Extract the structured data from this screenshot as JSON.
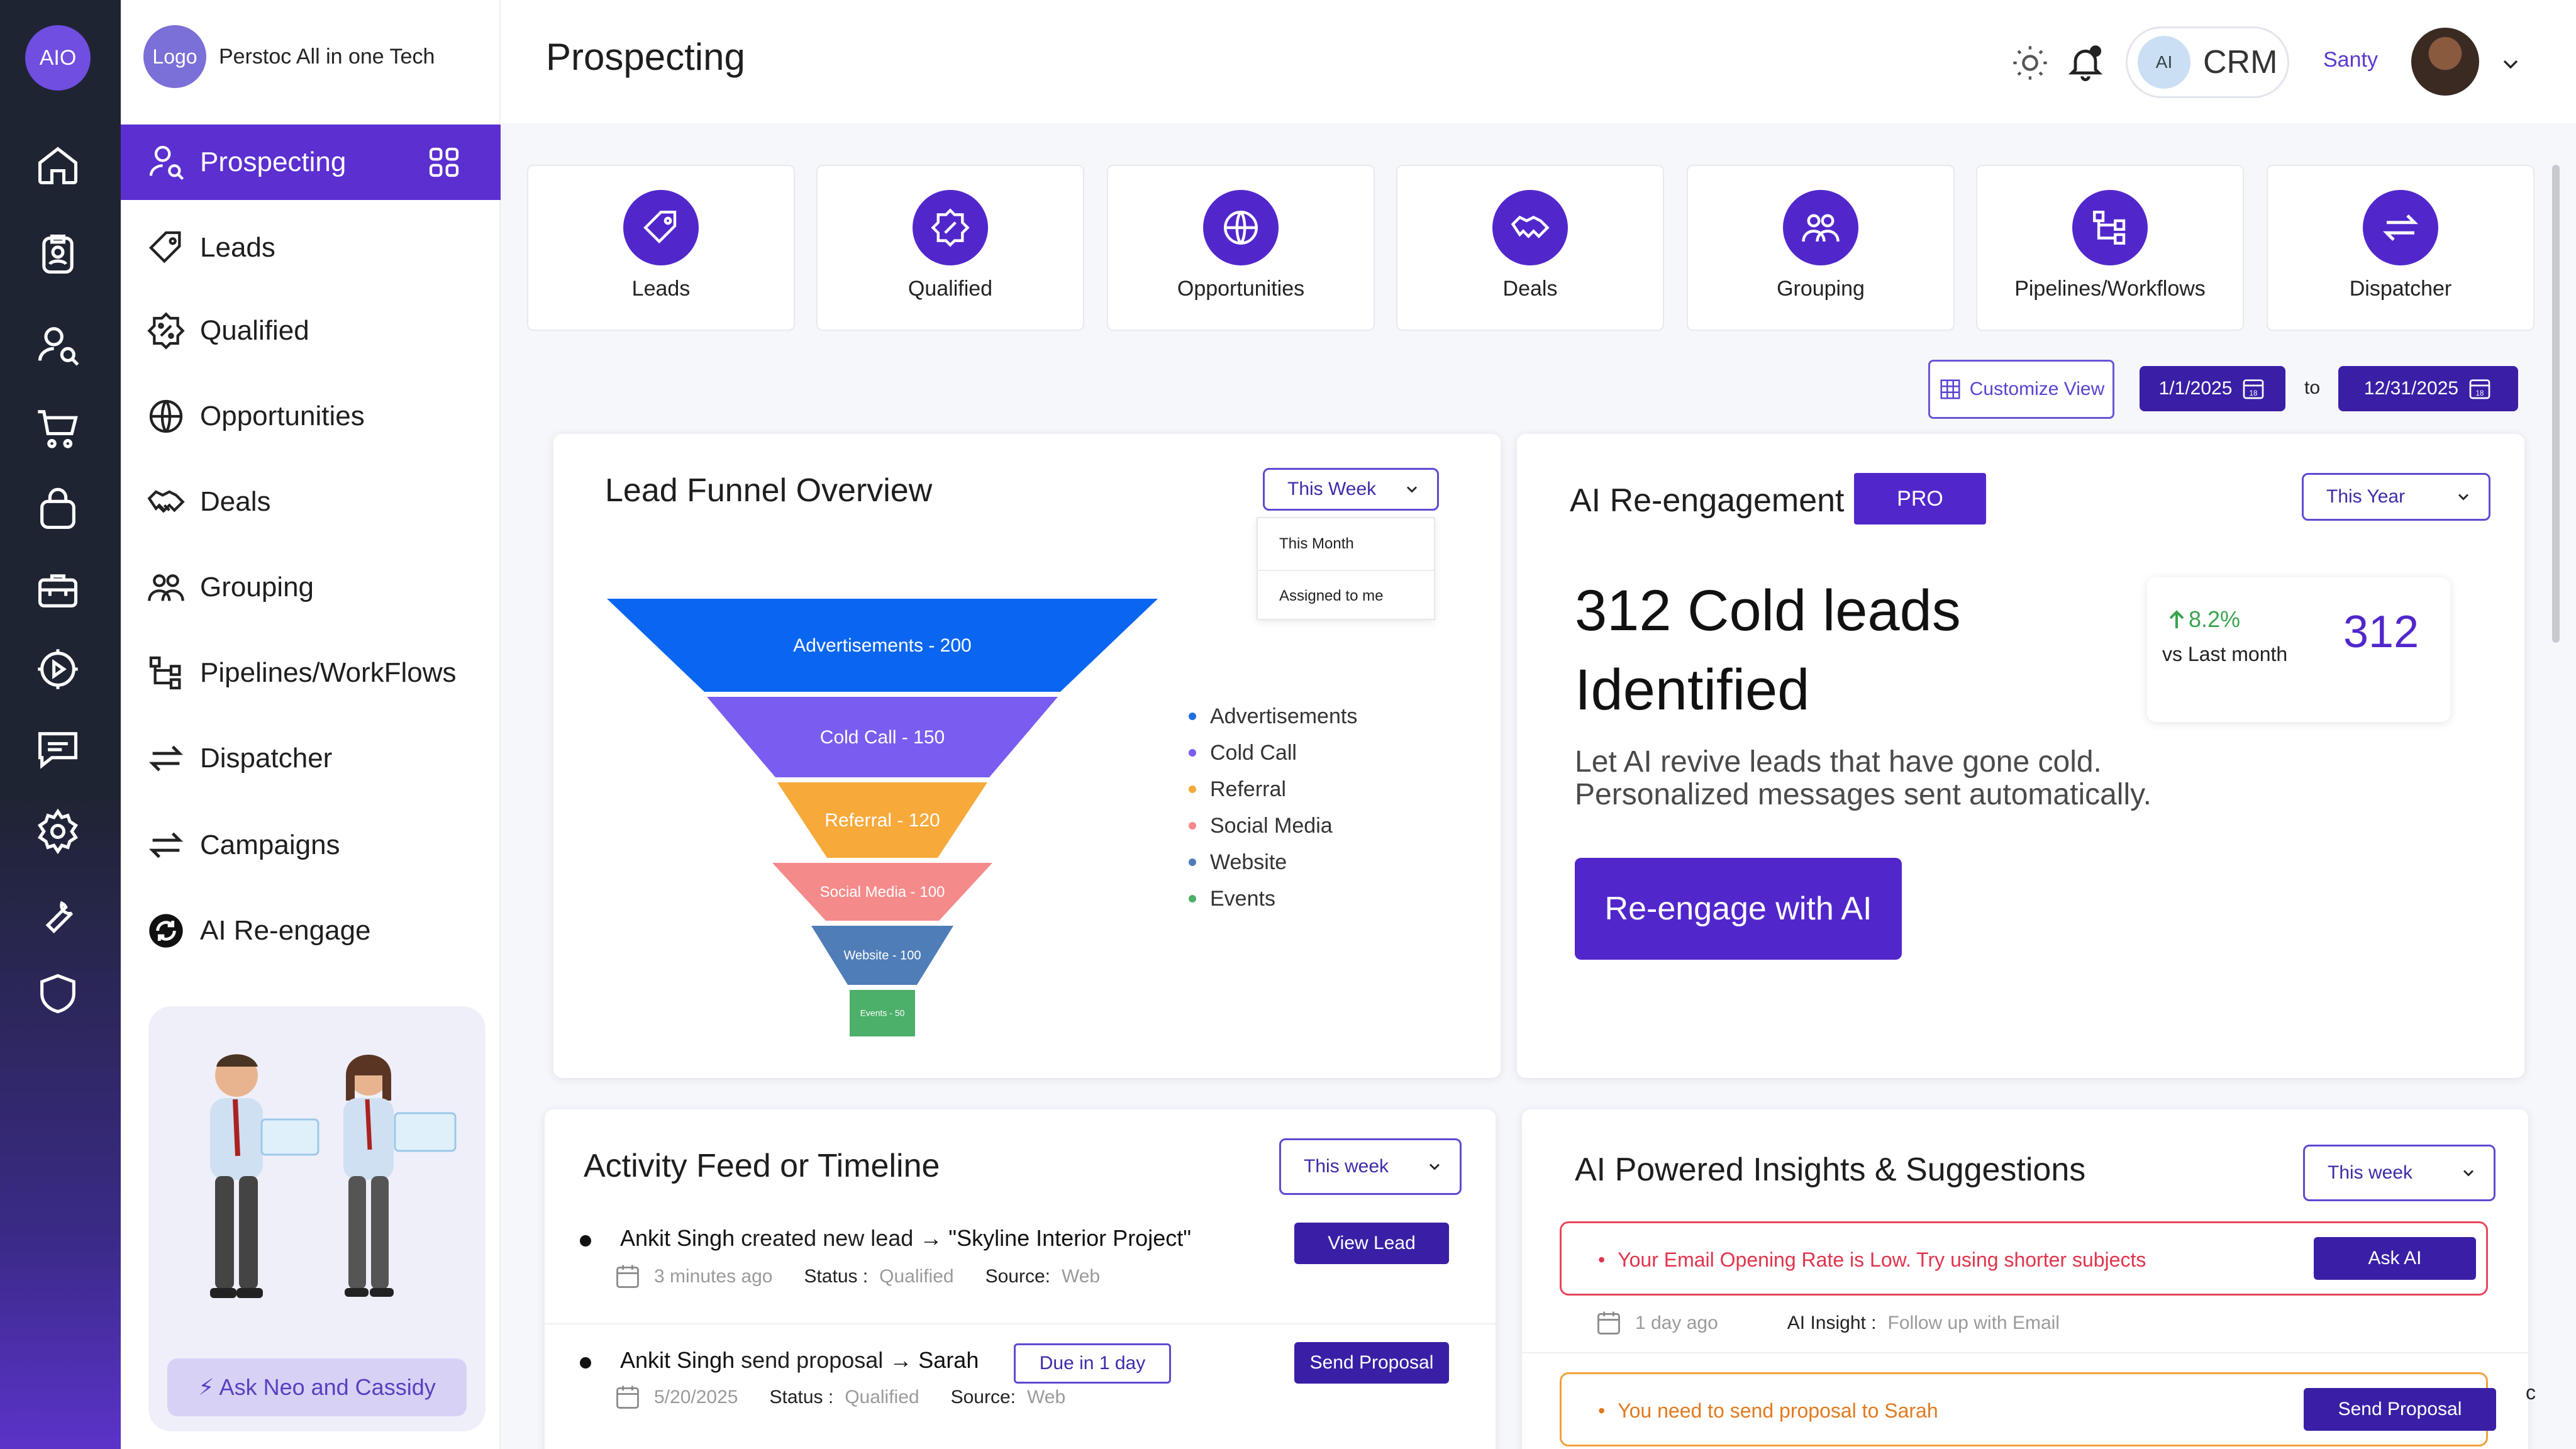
{
  "rail": {
    "logo": "AIO",
    "icons": [
      "home-icon",
      "clipboard-user-icon",
      "user-search-icon",
      "cart-icon",
      "bag-icon",
      "briefcase-icon",
      "play-gear-icon",
      "chat-icon",
      "settings-icon",
      "wrench-icon",
      "shield-icon"
    ]
  },
  "brand": {
    "logo": "Logo",
    "name": "Perstoc All in one Tech"
  },
  "nav": {
    "items": [
      {
        "label": "Prospecting"
      },
      {
        "label": "Leads"
      },
      {
        "label": "Qualified"
      },
      {
        "label": "Opportunities"
      },
      {
        "label": "Deals"
      },
      {
        "label": "Grouping"
      },
      {
        "label": "Pipelines/WorkFlows"
      },
      {
        "label": "Dispatcher"
      },
      {
        "label": "Campaigns"
      },
      {
        "label": "AI Re-engage"
      }
    ],
    "promo_button": "⚡ Ask Neo and Cassidy"
  },
  "header": {
    "title": "Prospecting",
    "crm_badge": "AI",
    "crm_label": "CRM",
    "user": "Santy"
  },
  "quick_cards": [
    {
      "label": "Leads"
    },
    {
      "label": "Qualified"
    },
    {
      "label": "Opportunities"
    },
    {
      "label": "Deals"
    },
    {
      "label": "Grouping"
    },
    {
      "label": "Pipelines/Workflows"
    },
    {
      "label": "Dispatcher"
    }
  ],
  "date_range": {
    "customize": "Customize View",
    "from": "1/1/2025",
    "to_label": "to",
    "to": "12/31/2025",
    "calendar_day": "18"
  },
  "funnel": {
    "title": "Lead Funnel Overview",
    "filter": "This Week",
    "menu": [
      "This Month",
      "Assigned to me"
    ],
    "stages": [
      {
        "label": "Advertisements - 200",
        "color": "#0a66f0"
      },
      {
        "label": "Cold Call - 150",
        "color": "#7b5cf0"
      },
      {
        "label": "Referral - 120",
        "color": "#f7a93a"
      },
      {
        "label": "Social Media - 100",
        "color": "#f58a8a"
      },
      {
        "label": "Website - 100",
        "color": "#4f7db8"
      },
      {
        "label": "Events - 50",
        "color": "#4caf6a"
      }
    ],
    "legend": [
      {
        "label": "Advertisements",
        "color": "#1f6fe0"
      },
      {
        "label": "Cold Call",
        "color": "#7b5cf0"
      },
      {
        "label": "Referral",
        "color": "#f7a93a"
      },
      {
        "label": "Social Media",
        "color": "#f58a8a"
      },
      {
        "label": "Website",
        "color": "#4f7db8"
      },
      {
        "label": "Events",
        "color": "#4caf6a"
      }
    ]
  },
  "reengage": {
    "title": "AI Re-engagement",
    "badge": "PRO",
    "filter": "This Year",
    "headline_1": "312 Cold leads",
    "headline_2": "Identified",
    "desc_1": "Let AI revive leads that have gone cold.",
    "desc_2": "Personalized messages sent automatically.",
    "stat_pct": "8.2%",
    "stat_sub": "vs Last month",
    "stat_num": "312",
    "button": "Re-engage with AI"
  },
  "activity": {
    "title": "Activity Feed or Timeline",
    "filter": "This week",
    "items": [
      {
        "actor": "Ankit Singh",
        "action": " created new lead ",
        "target": "→ \"Skyline Interior Project\"",
        "time": "3 minutes ago",
        "status_label": "Status :",
        "status": "Qualified",
        "source_label": "Source:",
        "source": "Web",
        "button": "View Lead"
      },
      {
        "actor": "Ankit Singh",
        "action": " send proposal ",
        "target": "→ Sarah",
        "due": "Due in 1 day",
        "time": "5/20/2025",
        "status_label": "Status :",
        "status": "Qualified",
        "source_label": "Source:",
        "source": "Web",
        "button": "Send Proposal"
      }
    ]
  },
  "insights": {
    "title": "AI Powered Insights & Suggestions",
    "filter": "This week",
    "items": [
      {
        "text": "Your Email Opening Rate is Low. Try using shorter subjects",
        "button": "Ask AI",
        "time": "1 day ago",
        "insight_label": "AI Insight :",
        "insight": "Follow up with Email",
        "color": "#e8455c"
      },
      {
        "text": "You need to send proposal to Sarah",
        "button": "Send Proposal",
        "color": "#f3a03a"
      }
    ],
    "edge_text": "c"
  }
}
